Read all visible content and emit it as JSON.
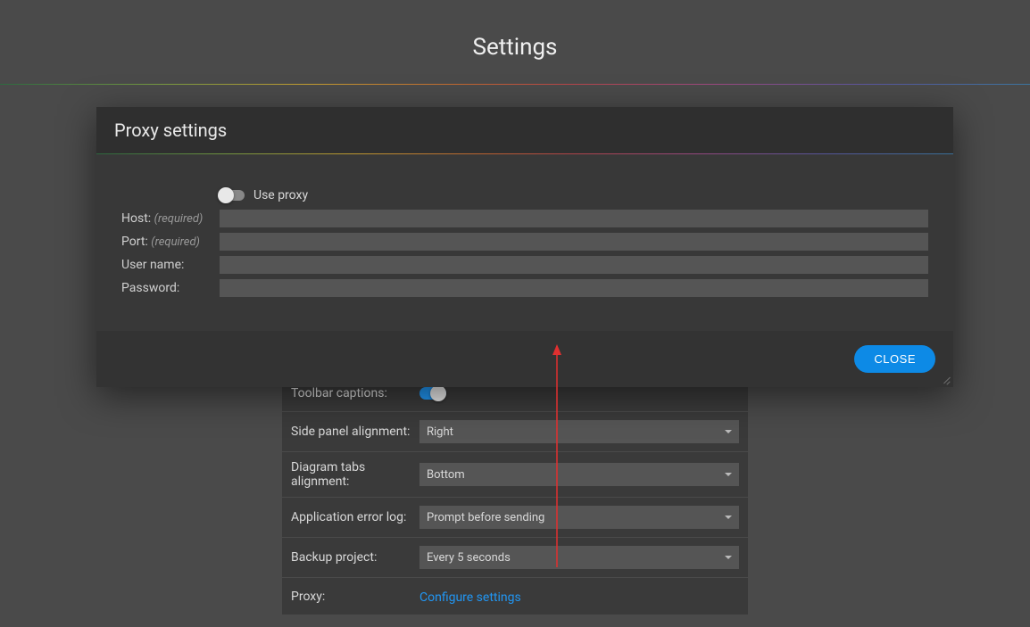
{
  "page": {
    "title": "Settings"
  },
  "settings": {
    "toolbar_captions": {
      "label": "Toolbar captions:"
    },
    "side_panel": {
      "label": "Side panel alignment:",
      "value": "Right"
    },
    "diagram_tabs": {
      "label": "Diagram tabs alignment:",
      "value": "Bottom"
    },
    "error_log": {
      "label": "Application error log:",
      "value": "Prompt before sending"
    },
    "backup": {
      "label": "Backup project:",
      "value": "Every 5 seconds"
    },
    "proxy": {
      "label": "Proxy:",
      "link": "Configure settings"
    }
  },
  "modal": {
    "title": "Proxy settings",
    "use_proxy_label": "Use proxy",
    "host_label": "Host:",
    "port_label": "Port:",
    "username_label": "User name:",
    "password_label": "Password:",
    "required_hint": "(required)",
    "close_label": "CLOSE"
  }
}
